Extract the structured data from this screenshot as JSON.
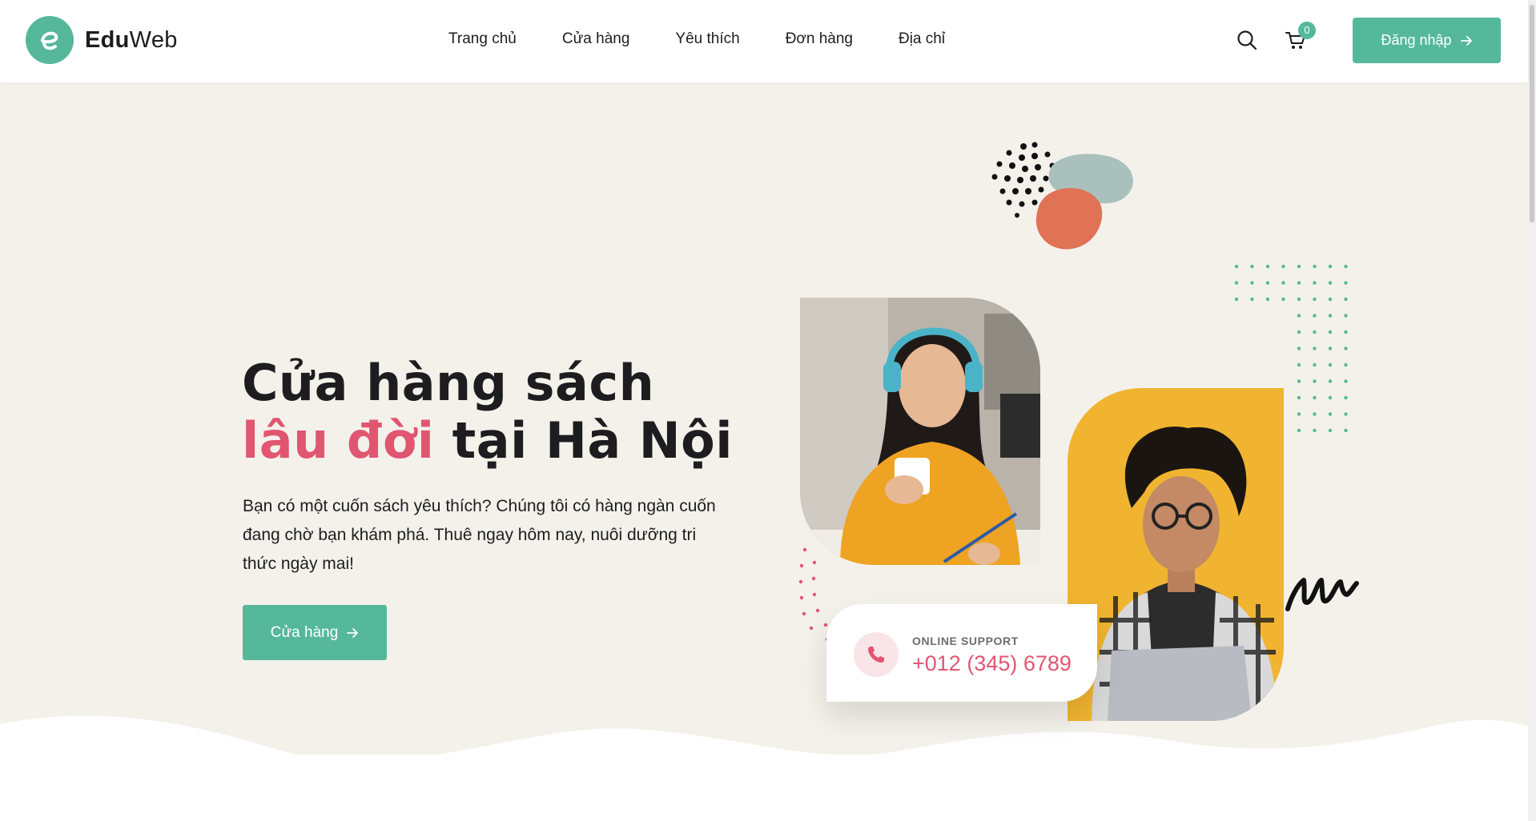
{
  "brand": {
    "name_bold": "Edu",
    "name_light": "Web",
    "color": "#55b89a"
  },
  "nav": {
    "items": [
      {
        "label": "Trang chủ"
      },
      {
        "label": "Cửa hàng"
      },
      {
        "label": "Yêu thích"
      },
      {
        "label": "Đơn hàng"
      },
      {
        "label": "Địa chỉ"
      }
    ]
  },
  "header": {
    "search_icon": "search-icon",
    "cart_icon": "cart-icon",
    "cart_count": "0",
    "login_label": "Đăng nhập"
  },
  "hero": {
    "title_line1": "Cửa hàng sách",
    "title_accent": "lâu đời",
    "title_rest": " tại Hà Nội",
    "description": "Bạn có một cuốn sách yêu thích? Chúng tôi có hàng ngàn cuốn đang chờ bạn khám phá. Thuê ngay hôm nay, nuôi dưỡng tri thức ngày mai!",
    "cta_label": "Cửa hàng",
    "accent_color": "#e05670",
    "background_color": "#f4f1eb"
  },
  "support": {
    "label": "ONLINE SUPPORT",
    "phone": "+012 (345) 6789",
    "icon": "phone-icon"
  }
}
